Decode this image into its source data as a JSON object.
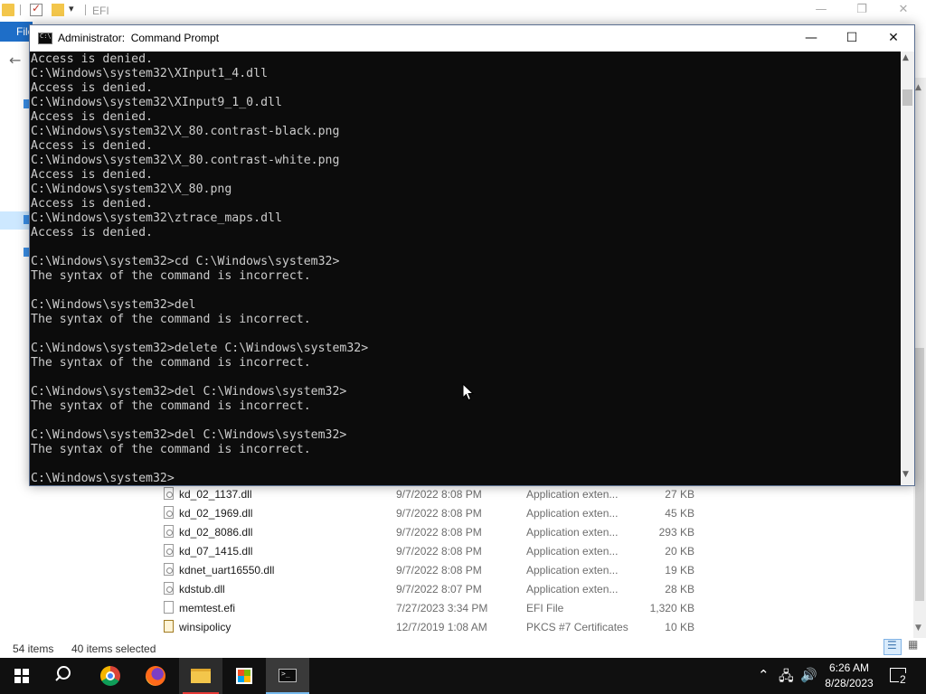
{
  "explorer": {
    "title": "EFI",
    "file_tab": "File",
    "files": [
      {
        "name": "kd_02_1137.dll",
        "date": "9/7/2022 8:08 PM",
        "type": "Application exten...",
        "size": "27 KB"
      },
      {
        "name": "kd_02_1969.dll",
        "date": "9/7/2022 8:08 PM",
        "type": "Application exten...",
        "size": "45 KB"
      },
      {
        "name": "kd_02_8086.dll",
        "date": "9/7/2022 8:08 PM",
        "type": "Application exten...",
        "size": "293 KB"
      },
      {
        "name": "kd_07_1415.dll",
        "date": "9/7/2022 8:08 PM",
        "type": "Application exten...",
        "size": "20 KB"
      },
      {
        "name": "kdnet_uart16550.dll",
        "date": "9/7/2022 8:08 PM",
        "type": "Application exten...",
        "size": "19 KB"
      },
      {
        "name": "kdstub.dll",
        "date": "9/7/2022 8:07 PM",
        "type": "Application exten...",
        "size": "28 KB"
      },
      {
        "name": "memtest.efi",
        "date": "7/27/2023 3:34 PM",
        "type": "EFI File",
        "size": "1,320 KB"
      },
      {
        "name": "winsipolicy",
        "date": "12/7/2019 1:08 AM",
        "type": "PKCS #7 Certificates",
        "size": "10 KB"
      }
    ],
    "status": {
      "item_count": "54 items",
      "selected": "40 items selected"
    }
  },
  "cmd": {
    "title": "Administrator:  Command Prompt",
    "lines": [
      "Access is denied.",
      "C:\\Windows\\system32\\XInput1_4.dll",
      "Access is denied.",
      "C:\\Windows\\system32\\XInput9_1_0.dll",
      "Access is denied.",
      "C:\\Windows\\system32\\X_80.contrast-black.png",
      "Access is denied.",
      "C:\\Windows\\system32\\X_80.contrast-white.png",
      "Access is denied.",
      "C:\\Windows\\system32\\X_80.png",
      "Access is denied.",
      "C:\\Windows\\system32\\ztrace_maps.dll",
      "Access is denied.",
      "",
      "C:\\Windows\\system32>cd C:\\Windows\\system32>",
      "The syntax of the command is incorrect.",
      "",
      "C:\\Windows\\system32>del",
      "The syntax of the command is incorrect.",
      "",
      "C:\\Windows\\system32>delete C:\\Windows\\system32>",
      "The syntax of the command is incorrect.",
      "",
      "C:\\Windows\\system32>del C:\\Windows\\system32>",
      "The syntax of the command is incorrect.",
      "",
      "C:\\Windows\\system32>del C:\\Windows\\system32>",
      "The syntax of the command is incorrect.",
      "",
      "C:\\Windows\\system32>"
    ]
  },
  "taskbar": {
    "time": "6:26 AM",
    "date": "8/28/2023",
    "notification_count": "2",
    "pinned": [
      "start",
      "search",
      "chrome",
      "firefox",
      "file-explorer",
      "microsoft-store",
      "command-prompt"
    ]
  },
  "colors": {
    "console_bg": "#0c0c0c",
    "console_text": "#cccccc",
    "taskbar_bg": "#101010",
    "file_tab_blue": "#1e6ec8",
    "active_indicator": "#76b9ed"
  }
}
